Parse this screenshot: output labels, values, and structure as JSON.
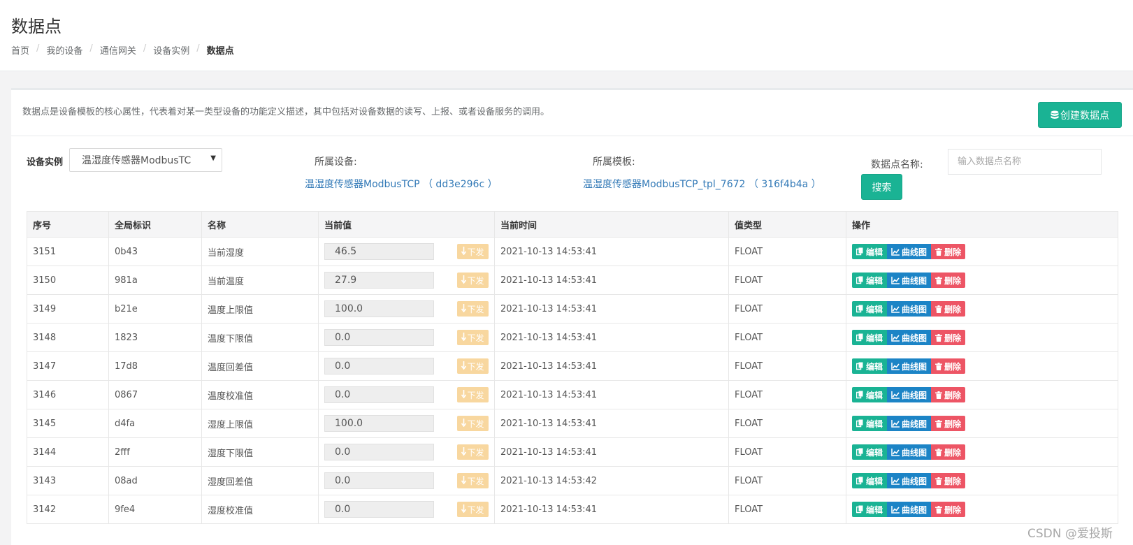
{
  "page": {
    "title": "数据点",
    "breadcrumb": [
      "首页",
      "我的设备",
      "通信网关",
      "设备实例",
      "数据点"
    ]
  },
  "header": {
    "description": "数据点是设备模板的核心属性，代表着对某一类型设备的功能定义描述，其中包括对设备数据的读写、上报、或者设备服务的调用。",
    "create_button": "创建数据点"
  },
  "filters": {
    "instance_label": "设备实例",
    "instance_value": "温湿度传感器ModbusTC",
    "device_label": "所属设备:",
    "device_link": "温湿度传感器ModbusTCP （ dd3e296c ）",
    "template_label": "所属模板:",
    "template_link": "温湿度传感器ModbusTCP_tpl_7672 （ 316f4b4a ）",
    "point_name_label": "数据点名称:",
    "point_name_placeholder": "输入数据点名称",
    "search_button": "搜索"
  },
  "table": {
    "columns": [
      "序号",
      "全局标识",
      "名称",
      "当前值",
      "当前时间",
      "值类型",
      "操作"
    ],
    "send_label": "下发",
    "actions": {
      "edit": "编辑",
      "chart": "曲线图",
      "delete": "删除"
    },
    "rows": [
      {
        "id": "3151",
        "gid": "0b43",
        "name": "当前湿度",
        "value": "46.5",
        "time": "2021-10-13 14:53:41",
        "type": "FLOAT"
      },
      {
        "id": "3150",
        "gid": "981a",
        "name": "当前温度",
        "value": "27.9",
        "time": "2021-10-13 14:53:41",
        "type": "FLOAT"
      },
      {
        "id": "3149",
        "gid": "b21e",
        "name": "温度上限值",
        "value": "100.0",
        "time": "2021-10-13 14:53:41",
        "type": "FLOAT"
      },
      {
        "id": "3148",
        "gid": "1823",
        "name": "温度下限值",
        "value": "0.0",
        "time": "2021-10-13 14:53:41",
        "type": "FLOAT"
      },
      {
        "id": "3147",
        "gid": "17d8",
        "name": "温度回差值",
        "value": "0.0",
        "time": "2021-10-13 14:53:41",
        "type": "FLOAT"
      },
      {
        "id": "3146",
        "gid": "0867",
        "name": "温度校准值",
        "value": "0.0",
        "time": "2021-10-13 14:53:41",
        "type": "FLOAT"
      },
      {
        "id": "3145",
        "gid": "d4fa",
        "name": "湿度上限值",
        "value": "100.0",
        "time": "2021-10-13 14:53:41",
        "type": "FLOAT"
      },
      {
        "id": "3144",
        "gid": "2fff",
        "name": "湿度下限值",
        "value": "0.0",
        "time": "2021-10-13 14:53:41",
        "type": "FLOAT"
      },
      {
        "id": "3143",
        "gid": "08ad",
        "name": "湿度回差值",
        "value": "0.0",
        "time": "2021-10-13 14:53:42",
        "type": "FLOAT"
      },
      {
        "id": "3142",
        "gid": "9fe4",
        "name": "湿度校准值",
        "value": "0.0",
        "time": "2021-10-13 14:53:41",
        "type": "FLOAT"
      }
    ]
  },
  "watermark": "CSDN @爱投斯",
  "colors": {
    "primary": "#1ab394",
    "info": "#1c84c6",
    "danger": "#ed5565",
    "warning_light": "#f8d79f",
    "link": "#337ab7"
  }
}
